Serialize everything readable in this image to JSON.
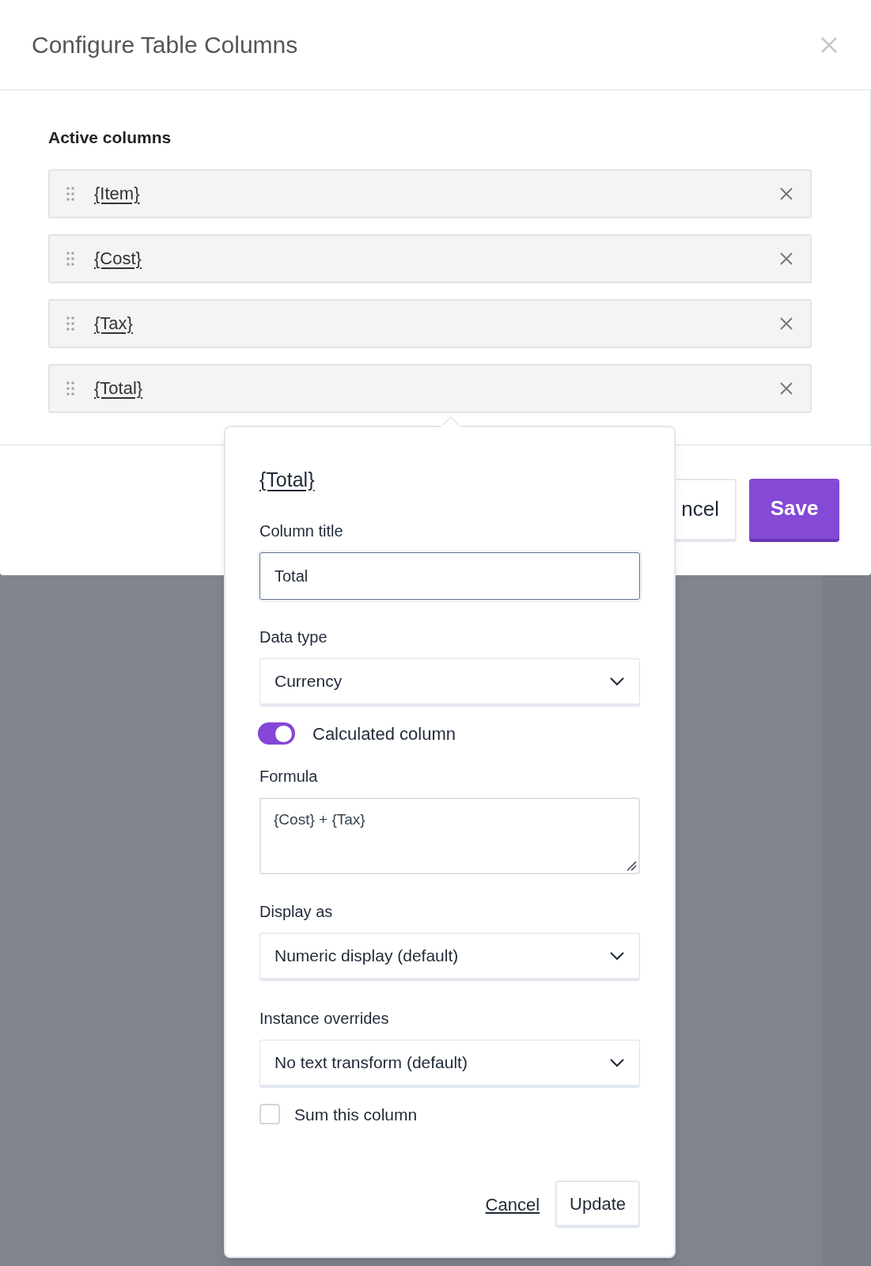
{
  "dialog": {
    "title": "Configure Table Columns",
    "section_label": "Active columns",
    "columns": [
      {
        "label": "{Item}"
      },
      {
        "label": "{Cost}"
      },
      {
        "label": "{Tax}"
      },
      {
        "label": "{Total}"
      }
    ],
    "footer_buttons": [
      {
        "label": "ncel",
        "kind": "secondary"
      },
      {
        "label": "Save",
        "kind": "primary"
      }
    ]
  },
  "popover": {
    "title": "{Total}",
    "fields": [
      {
        "kind": "input",
        "label": "Column title",
        "value": "Total"
      },
      {
        "kind": "select",
        "label": "Data type",
        "value": "Currency"
      },
      {
        "kind": "toggle",
        "label": "Calculated column",
        "on": true
      },
      {
        "kind": "textarea",
        "label": "Formula",
        "value": "{Cost} + {Tax}"
      },
      {
        "kind": "select",
        "label": "Display as",
        "value": "Numeric display (default)"
      },
      {
        "kind": "select",
        "label": "Instance overrides",
        "value": "No text transform (default)"
      },
      {
        "kind": "checkbox",
        "label": "Sum this column",
        "checked": false
      }
    ],
    "cancel": "Cancel",
    "update": "Update"
  }
}
